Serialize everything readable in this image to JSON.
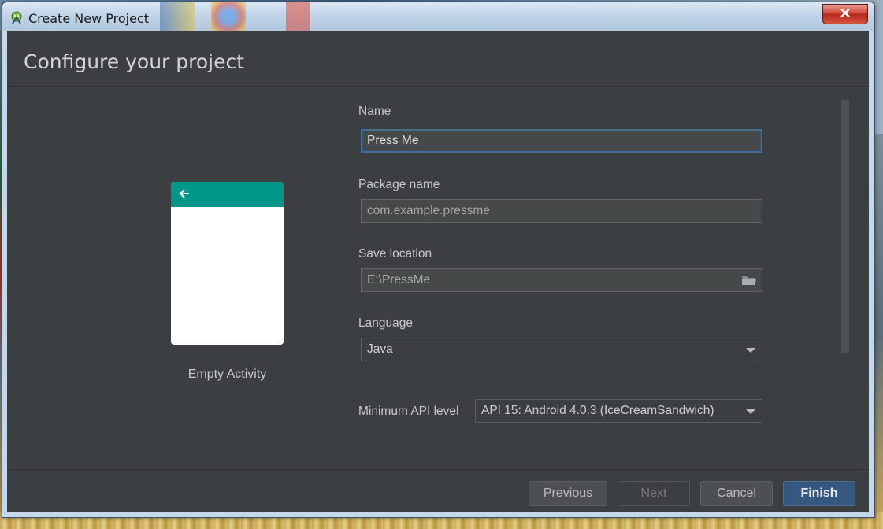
{
  "window": {
    "title": "Create New Project",
    "close_glyph": "✕"
  },
  "header": {
    "title": "Configure your project"
  },
  "preview": {
    "template_name": "Empty Activity",
    "toolbar_color": "#009688"
  },
  "form": {
    "name": {
      "label": "Name",
      "value": "Press Me"
    },
    "package": {
      "label": "Package name",
      "value": "com.example.pressme"
    },
    "location": {
      "label": "Save location",
      "value": "E:\\PressMe"
    },
    "language": {
      "label": "Language",
      "selected": "Java"
    },
    "min_api": {
      "label": "Minimum API level",
      "selected": "API 15: Android 4.0.3 (IceCreamSandwich)"
    }
  },
  "buttons": {
    "previous": "Previous",
    "next": "Next",
    "cancel": "Cancel",
    "finish": "Finish"
  },
  "colors": {
    "panel": "#3c3f41",
    "accent": "#365880",
    "focus_border": "#466d94"
  }
}
